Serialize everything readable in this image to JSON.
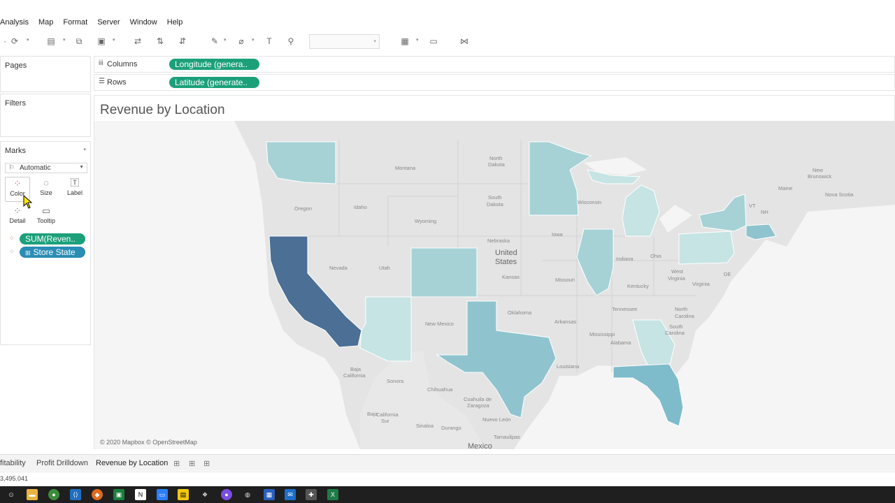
{
  "menu": [
    "Analysis",
    "Map",
    "Format",
    "Server",
    "Window",
    "Help"
  ],
  "left": {
    "pages_title": "Pages",
    "filters_title": "Filters",
    "marks_title": "Marks",
    "marks_type": "Automatic",
    "mark_buttons": [
      "Color",
      "Size",
      "Label",
      "Detail",
      "Tooltip"
    ],
    "pills": [
      "SUM(Reven..",
      "Store State"
    ]
  },
  "shelves": {
    "columns_label": "Columns",
    "columns_pill": "Longitude (genera..",
    "rows_label": "Rows",
    "rows_pill": "Latitude (generate.."
  },
  "viz": {
    "title": "Revenue by Location",
    "credit": "© 2020 Mapbox © OpenStreetMap",
    "labels": {
      "montana": "Montana",
      "north_dakota_1": "North",
      "north_dakota_2": "Dakota",
      "south_dakota_1": "South",
      "south_dakota_2": "Dakota",
      "oregon": "Oregon",
      "idaho": "Idaho",
      "wyoming": "Wyoming",
      "nebraska": "Nebraska",
      "united_states_1": "United",
      "united_states_2": "States",
      "nevada": "Nevada",
      "utah": "Utah",
      "kansas": "Kansas",
      "iowa": "Iowa",
      "missouri": "Missouri",
      "wisconsin": "Wisconsin",
      "indiana": "Indiana",
      "ohio": "Ohio",
      "kentucky": "Kentucky",
      "west_virginia_1": "West",
      "west_virginia_2": "Virginia",
      "virginia": "Virginia",
      "tennessee": "Tennessee",
      "oklahoma": "Oklahoma",
      "arkansas": "Arkansas",
      "new_mexico": "New Mexico",
      "mississippi": "Mississippi",
      "alabama": "Alabama",
      "louisiana": "Louisiana",
      "north_carolina_1": "North",
      "north_carolina_2": "Carolina",
      "south_carolina_1": "South",
      "south_carolina_2": "Carolina",
      "maine": "Maine",
      "new_brunswick_1": "New",
      "new_brunswick_2": "Brunswick",
      "nova_scotia": "Nova Scotia",
      "vt": "VT",
      "nh": "NH",
      "de": "DE",
      "baja_california_1": "Baja",
      "baja_california_2": "California",
      "sonora": "Sonora",
      "chihuahua": "Chihuahua",
      "coahuila_1": "Coahuila de",
      "coahuila_2": "Zaragoza",
      "nuevo_leon": "Nuevo León",
      "baja_california_sur_1": "Baja",
      "baja_california_sur_2": "California",
      "baja_california_sur_3": "Sur",
      "sinaloa": "Sinaloa",
      "durango": "Durango",
      "tamaulipas": "Tamaulipas",
      "mexico": "Mexico"
    },
    "colors": {
      "california": "#4b6f95",
      "florida": "#7fbccb",
      "texas": "#8fc4cf",
      "mid": "#a6d2d6",
      "light": "#c5e4e3",
      "land": "#e4e4e4",
      "water": "#f5f5f5"
    }
  },
  "tabs": [
    "fitability",
    "Profit Drilldown",
    "Revenue by Location"
  ],
  "status_text": "3,495.041"
}
